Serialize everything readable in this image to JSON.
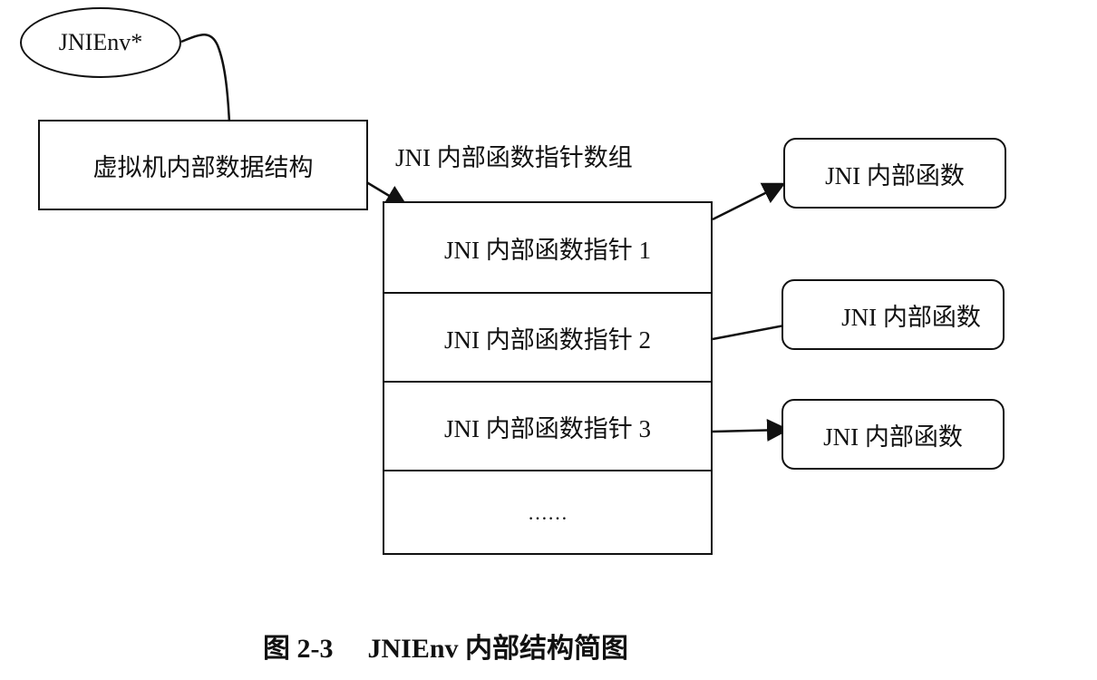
{
  "env_pointer": "JNIEnv*",
  "vm_structure": "虚拟机内部数据结构",
  "array_title": "JNI 内部函数指针数组",
  "array_cells": [
    "JNI 内部函数指针 1",
    "JNI 内部函数指针 2",
    "JNI 内部函数指针 3",
    "……"
  ],
  "functions": [
    "JNI 内部函数",
    "JNI 内部函数",
    "JNI 内部函数"
  ],
  "caption": {
    "number": "图 2-3",
    "title": "JNIEnv 内部结构简图"
  }
}
